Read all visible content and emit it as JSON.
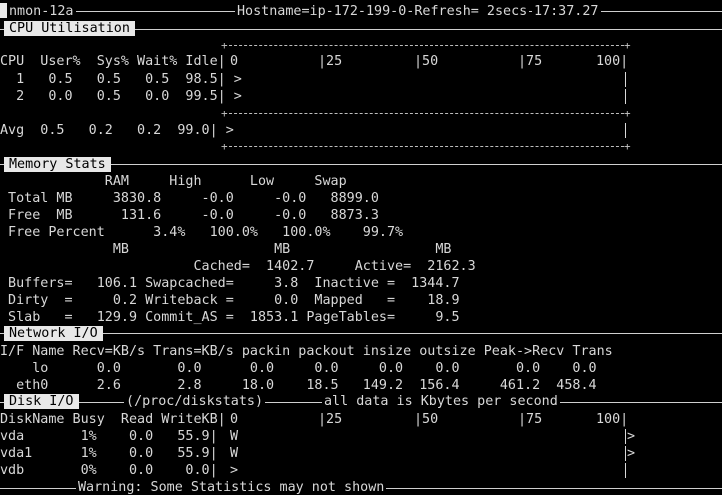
{
  "header": {
    "app": "nmon-12a",
    "hostname": "Hostname=ip-172-199-0-Refresh= 2secs",
    "time": "17:37.27"
  },
  "cpu": {
    "section_title": "CPU Utilisation",
    "header_line": "CPU  User%  Sys% Wait% Idle|",
    "scale": [
      "0",
      "|25",
      "|50",
      "|75",
      "100|"
    ],
    "rows": [
      "  1   0.5   0.5   0.5  98.5| >",
      "  2   0.0   0.5   0.0  99.5| >",
      "Avg  0.5   0.2   0.2  99.0| >"
    ]
  },
  "memory": {
    "section_title": "Memory Stats",
    "lines": [
      "             RAM     High      Low     Swap",
      " Total MB     3830.8     -0.0     -0.0   8899.0",
      " Free  MB      131.6     -0.0     -0.0   8873.3",
      " Free Percent      3.4%   100.0%   100.0%    99.7%",
      "              MB                  MB                  MB",
      "                        Cached=  1402.7     Active=  2162.3",
      " Buffers=   106.1 Swapcached=     3.8  Inactive =  1344.7",
      " Dirty  =     0.2 Writeback =     0.0  Mapped   =    18.9",
      " Slab   =   129.9 Commit_AS =  1853.1 PageTables=     9.5"
    ]
  },
  "network": {
    "section_title": "Network I/O",
    "header_line": "I/F Name Recv=KB/s Trans=KB/s packin packout insize outsize Peak->Recv Trans",
    "rows": [
      "    lo      0.0       0.0      0.0     0.0     0.0    0.0       0.0    0.0",
      "  eth0      2.6       2.8     18.0    18.5   149.2  156.4     461.2  458.4"
    ]
  },
  "disk": {
    "section_title": "Disk I/O",
    "source_label": "/proc/diskstats",
    "units_note": "all data is Kbytes per second",
    "header_line": "DiskName Busy  Read WriteKB|",
    "rows": [
      {
        "text": "vda       1%    0.0   55.9|",
        "bar": "W",
        "end": ">"
      },
      {
        "text": "vda1      1%    0.0   55.9|",
        "bar": "W",
        "end": ">"
      },
      {
        "text": "vdb       0%    0.0    0.0|",
        "bar": ">",
        "end": ""
      }
    ]
  },
  "footer": {
    "warning": "Warning: Some Statistics may not shown"
  }
}
